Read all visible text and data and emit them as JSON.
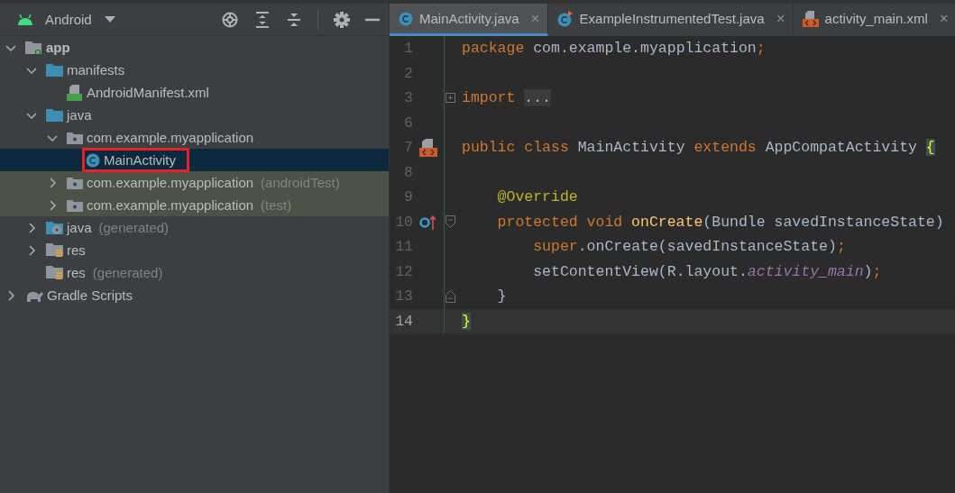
{
  "project_panel": {
    "view": "Android",
    "tree": [
      {
        "label": "app",
        "bold": true,
        "kind": "module",
        "expanded": true,
        "selected": false,
        "framed": false,
        "tinted": false,
        "children": [
          {
            "label": "manifests",
            "kind": "folder",
            "expanded": true,
            "selected": false,
            "framed": false,
            "tinted": false,
            "children": [
              {
                "label": "AndroidManifest.xml",
                "kind": "manifest",
                "selected": false,
                "framed": false,
                "tinted": false
              }
            ]
          },
          {
            "label": "java",
            "kind": "folder",
            "expanded": true,
            "selected": false,
            "framed": false,
            "tinted": false,
            "children": [
              {
                "label": "com.example.myapplication",
                "kind": "package",
                "expanded": true,
                "selected": false,
                "framed": false,
                "tinted": false,
                "children": [
                  {
                    "label": "MainActivity",
                    "kind": "class",
                    "selected": true,
                    "framed": true,
                    "tinted": false
                  }
                ]
              },
              {
                "label": "com.example.myapplication",
                "suffix": "(androidTest)",
                "kind": "package",
                "expanded": false,
                "selected": false,
                "framed": false,
                "tinted": true
              },
              {
                "label": "com.example.myapplication",
                "suffix": "(test)",
                "kind": "package",
                "expanded": false,
                "selected": false,
                "framed": false,
                "tinted": true
              }
            ]
          },
          {
            "label": "java",
            "suffix": "(generated)",
            "kind": "generated",
            "expanded": false,
            "selected": false,
            "framed": false,
            "tinted": false
          },
          {
            "label": "res",
            "kind": "resources",
            "expanded": false,
            "selected": false,
            "framed": false,
            "tinted": false
          },
          {
            "label": "res",
            "suffix": "(generated)",
            "kind": "resources",
            "selected": false,
            "framed": false,
            "tinted": false
          }
        ]
      },
      {
        "label": "Gradle Scripts",
        "kind": "gradle",
        "expanded": false,
        "selected": false,
        "framed": false,
        "tinted": false
      }
    ]
  },
  "editor": {
    "tabs": [
      {
        "label": "MainActivity.java",
        "kind": "class",
        "close": "×",
        "selected": true
      },
      {
        "label": "ExampleInstrumentedTest.java",
        "kind": "test",
        "close": "×",
        "selected": false
      },
      {
        "label": "activity_main.xml",
        "kind": "layout",
        "close": "×",
        "selected": false
      }
    ],
    "lines": [
      {
        "number": "1",
        "kind": "top",
        "current": false,
        "tokens": [
          {
            "kind": "keyword",
            "text": "package"
          },
          {
            "kind": "plain",
            "text": "com.example.myapplication"
          },
          {
            "kind": "keyword",
            "text": ";"
          }
        ]
      },
      {
        "number": "2",
        "kind": "top",
        "current": false
      },
      {
        "number": "3",
        "kind": "import",
        "current": false,
        "tokens": [
          {
            "kind": "keyword",
            "text": "import"
          },
          {
            "kind": "folded",
            "text": "..."
          }
        ]
      },
      {
        "number": "6",
        "kind": "top",
        "current": false
      },
      {
        "number": "7",
        "kind": "class",
        "current": false,
        "tokens": [
          {
            "kind": "keyword",
            "text": "public class"
          },
          {
            "kind": "plain",
            "text": "MainActivity"
          },
          {
            "kind": "keyword",
            "text": "extends"
          },
          {
            "kind": "plain",
            "text": "AppCompatActivity"
          },
          {
            "kind": "brace",
            "text": "{"
          }
        ]
      },
      {
        "number": "8",
        "kind": "top",
        "current": false
      },
      {
        "number": "9",
        "kind": "member",
        "current": false,
        "tokens": [
          {
            "kind": "annotation",
            "text": "@Override"
          }
        ]
      },
      {
        "number": "10",
        "kind": "method",
        "current": false,
        "tokens": [
          {
            "kind": "keyword",
            "text": "protected void"
          },
          {
            "kind": "method",
            "text": "onCreate"
          },
          {
            "kind": "plain",
            "text": "(Bundle savedInstanceState)"
          }
        ]
      },
      {
        "number": "11",
        "kind": "statement",
        "current": false,
        "tokens": [
          {
            "kind": "keyword",
            "text": "super"
          },
          {
            "kind": "plain",
            "text": ".onCreate(savedInstanceState)"
          },
          {
            "kind": "keyword",
            "text": ";"
          }
        ]
      },
      {
        "number": "12",
        "kind": "statement",
        "current": false,
        "tokens": [
          {
            "kind": "plain",
            "text": "setContentView(R.layout."
          },
          {
            "kind": "field",
            "text": "activity_main"
          },
          {
            "kind": "plain",
            "text": ")"
          },
          {
            "kind": "keyword",
            "text": ";"
          }
        ]
      },
      {
        "number": "13",
        "kind": "method_end",
        "current": false,
        "tokens": [
          {
            "kind": "plain",
            "text": "}"
          }
        ]
      },
      {
        "number": "14",
        "kind": "top",
        "current": true,
        "tokens": [
          {
            "kind": "brace",
            "text": "}"
          }
        ]
      }
    ]
  }
}
